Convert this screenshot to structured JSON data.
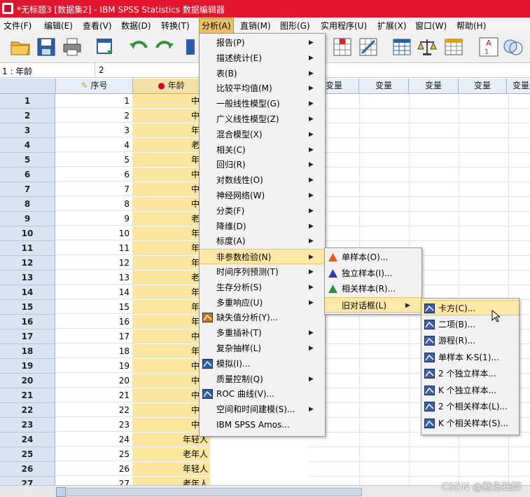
{
  "window": {
    "title": "*无标题3 [数据集2] - IBM SPSS Statistics 数据编辑器"
  },
  "menubar": [
    "文件(F)",
    "编辑(E)",
    "查看(V)",
    "数据(D)",
    "转换(T)",
    "分析(A)",
    "直销(M)",
    "图形(G)",
    "实用程序(U)",
    "扩展(X)",
    "窗口(W)",
    "帮助(H)"
  ],
  "cellref": {
    "ref": "1 : 年龄",
    "value": "2"
  },
  "grid": {
    "headers": [
      "序号",
      "年龄",
      "变量",
      "变量",
      "变量",
      "变量",
      "变量",
      "变量",
      "变量"
    ],
    "rows": [
      {
        "n": "1",
        "v": "1",
        "age": "中年"
      },
      {
        "n": "2",
        "v": "2",
        "age": "中年"
      },
      {
        "n": "3",
        "v": "3",
        "age": "年轻"
      },
      {
        "n": "4",
        "v": "4",
        "age": "老年"
      },
      {
        "n": "5",
        "v": "5",
        "age": "年轻"
      },
      {
        "n": "6",
        "v": "6",
        "age": "中年"
      },
      {
        "n": "7",
        "v": "7",
        "age": "中年"
      },
      {
        "n": "8",
        "v": "8",
        "age": "中年"
      },
      {
        "n": "9",
        "v": "9",
        "age": "老年"
      },
      {
        "n": "10",
        "v": "10",
        "age": "年轻"
      },
      {
        "n": "11",
        "v": "11",
        "age": "年轻"
      },
      {
        "n": "12",
        "v": "12",
        "age": "年轻"
      },
      {
        "n": "13",
        "v": "13",
        "age": "老年"
      },
      {
        "n": "14",
        "v": "14",
        "age": "年轻"
      },
      {
        "n": "15",
        "v": "15",
        "age": "年轻"
      },
      {
        "n": "16",
        "v": "16",
        "age": "年轻"
      },
      {
        "n": "17",
        "v": "17",
        "age": "中年"
      },
      {
        "n": "18",
        "v": "18",
        "age": "年轻"
      },
      {
        "n": "19",
        "v": "19",
        "age": "中年"
      },
      {
        "n": "20",
        "v": "20",
        "age": "中年"
      },
      {
        "n": "21",
        "v": "21",
        "age": "中年"
      },
      {
        "n": "22",
        "v": "22",
        "age": "中年"
      },
      {
        "n": "23",
        "v": "23",
        "age": "中年"
      },
      {
        "n": "24",
        "v": "24",
        "age": "年轻人"
      },
      {
        "n": "25",
        "v": "25",
        "age": "老年人"
      },
      {
        "n": "26",
        "v": "26",
        "age": "年轻人"
      },
      {
        "n": "27",
        "v": "27",
        "age": "老年人"
      }
    ]
  },
  "analyze_menu": {
    "items": [
      {
        "label": "报告(P)",
        "sub": true
      },
      {
        "label": "描述统计(E)",
        "sub": true
      },
      {
        "label": "表(B)",
        "sub": true
      },
      {
        "label": "比较平均值(M)",
        "sub": true
      },
      {
        "label": "一般线性模型(G)",
        "sub": true
      },
      {
        "label": "广义线性模型(Z)",
        "sub": true
      },
      {
        "label": "混合模型(X)",
        "sub": true
      },
      {
        "label": "相关(C)",
        "sub": true
      },
      {
        "label": "回归(R)",
        "sub": true
      },
      {
        "label": "对数线性(O)",
        "sub": true
      },
      {
        "label": "神经网络(W)",
        "sub": true
      },
      {
        "label": "分类(F)",
        "sub": true
      },
      {
        "label": "降维(D)",
        "sub": true
      },
      {
        "label": "标度(A)",
        "sub": true
      },
      {
        "label": "非参数检验(N)",
        "sub": true,
        "highlight": true
      },
      {
        "label": "时间序列预测(T)",
        "sub": true
      },
      {
        "label": "生存分析(S)",
        "sub": true
      },
      {
        "label": "多重响应(U)",
        "sub": true
      },
      {
        "label": "缺失值分析(Y)...",
        "icon": "missing-value-icon"
      },
      {
        "label": "多重插补(T)",
        "sub": true
      },
      {
        "label": "复杂抽样(L)",
        "sub": true
      },
      {
        "label": "模拟(I)...",
        "icon": "simulation-icon"
      },
      {
        "label": "质量控制(Q)",
        "sub": true
      },
      {
        "label": "ROC 曲线(V)...",
        "icon": "roc-curve-icon"
      },
      {
        "label": "空间和时间建模(S)...",
        "sub": true
      },
      {
        "label": "IBM SPSS Amos..."
      }
    ]
  },
  "nonparam_menu": {
    "items": [
      {
        "label": "单样本(O)...",
        "icon": "one-sample-icon"
      },
      {
        "label": "独立样本(I)...",
        "icon": "independent-samples-icon"
      },
      {
        "label": "相关样本(R)...",
        "icon": "related-samples-icon"
      },
      {
        "label": "旧对话框(L)",
        "sub": true,
        "highlight": true
      }
    ]
  },
  "legacy_menu": {
    "items": [
      {
        "label": "卡方(C)...",
        "icon": "chi-square-icon",
        "highlight": true
      },
      {
        "label": "二项(B)...",
        "icon": "binomial-icon"
      },
      {
        "label": "游程(R)...",
        "icon": "runs-icon"
      },
      {
        "label": "单样本 K-S(1)...",
        "icon": "ks-one-sample-icon"
      },
      {
        "label": "2 个独立样本...",
        "icon": "two-independent-icon"
      },
      {
        "label": "K 个独立样本...",
        "icon": "k-independent-icon"
      },
      {
        "label": "2 个相关样本(L)...",
        "icon": "two-related-icon"
      },
      {
        "label": "K 个相关样本(S)...",
        "icon": "k-related-icon"
      }
    ]
  },
  "watermark": "CSDN @黯伤独醉",
  "colors": {
    "title_bar": "#e2152e",
    "age_column": "#fde79e",
    "menu_highlight": "#fde8a8"
  }
}
